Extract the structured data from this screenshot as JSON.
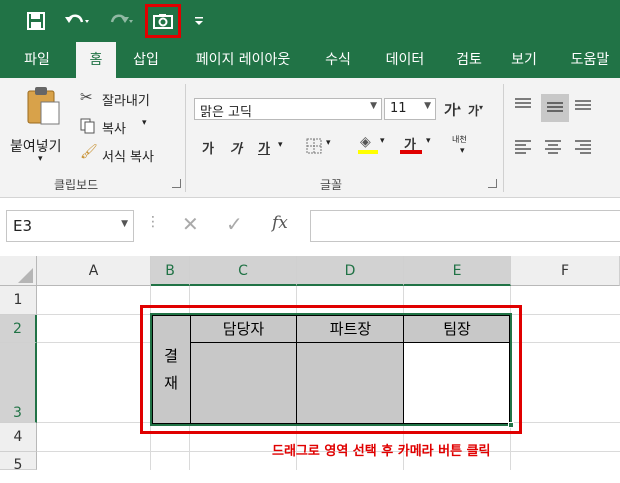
{
  "quick_access": {
    "save_icon": "save-icon",
    "undo_icon": "undo-icon",
    "redo_icon": "redo-icon",
    "camera_icon": "camera-icon",
    "customize_icon": "customize-qat-icon"
  },
  "tabs": [
    "파일",
    "홈",
    "삽입",
    "페이지 레이아웃",
    "수식",
    "데이터",
    "검토",
    "보기",
    "도움말"
  ],
  "active_tab": "홈",
  "clipboard": {
    "paste": "붙여넣기",
    "cut": "잘라내기",
    "copy": "복사",
    "format_painter": "서식 복사",
    "group_label": "클립보드"
  },
  "font": {
    "font_name": "맑은 고딕",
    "font_size": "11",
    "bold": "가",
    "italic": "가",
    "underline": "가",
    "font_color_glyph": "가",
    "phonetic": "내천",
    "grow_glyph": "가",
    "shrink_glyph": "가",
    "group_label": "글꼴",
    "font_color": "#e00000",
    "fill_color": "#ffff00"
  },
  "formula_bar": {
    "name_box": "E3",
    "fx": "fx",
    "formula": ""
  },
  "columns": [
    "A",
    "B",
    "C",
    "D",
    "E",
    "F"
  ],
  "rows": [
    "1",
    "2",
    "3",
    "4",
    "5"
  ],
  "table": {
    "approval_label_1": "결",
    "approval_label_2": "재",
    "headers": [
      "담당자",
      "파트장",
      "팀장"
    ]
  },
  "instruction": "드래그로 영역 선택 후 카메라 버튼 클릭",
  "colors": {
    "excel_green": "#217346",
    "highlight_red": "#e00000",
    "cell_gray": "#c8c8c8"
  }
}
